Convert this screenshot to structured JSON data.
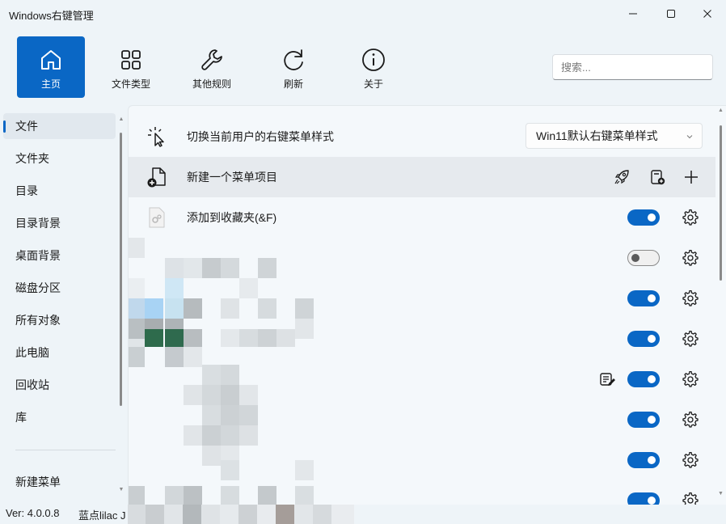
{
  "window": {
    "title": "Windows右键管理"
  },
  "toolbar": {
    "items": [
      {
        "label": "主页",
        "icon": "home-icon"
      },
      {
        "label": "文件类型",
        "icon": "grid-icon"
      },
      {
        "label": "其他规则",
        "icon": "wrench-icon"
      },
      {
        "label": "刷新",
        "icon": "refresh-icon"
      },
      {
        "label": "关于",
        "icon": "info-icon"
      }
    ],
    "search_placeholder": "搜索..."
  },
  "sidebar": {
    "items": [
      {
        "label": "文件",
        "selected": true
      },
      {
        "label": "文件夹"
      },
      {
        "label": "目录"
      },
      {
        "label": "目录背景"
      },
      {
        "label": "桌面背景"
      },
      {
        "label": "磁盘分区"
      },
      {
        "label": "所有对象"
      },
      {
        "label": "此电脑"
      },
      {
        "label": "回收站"
      },
      {
        "label": "库"
      }
    ],
    "bottom_item": "新建菜单"
  },
  "content": {
    "switch_row": {
      "label": "切换当前用户的右键菜单样式",
      "select_value": "Win11默认右键菜单样式"
    },
    "new_row": {
      "label": "新建一个菜单项目"
    },
    "first_item": {
      "label": "添加到收藏夹(&F)",
      "enabled": true
    },
    "item_states": [
      false,
      true,
      true,
      true,
      true,
      true,
      true
    ]
  },
  "statusbar": {
    "version": "Ver: 4.0.0.8",
    "author": "蓝点lilac J"
  },
  "colors": {
    "accent": "#0a67c5",
    "background": "#eef4f8",
    "content": "#f4f8fb"
  }
}
